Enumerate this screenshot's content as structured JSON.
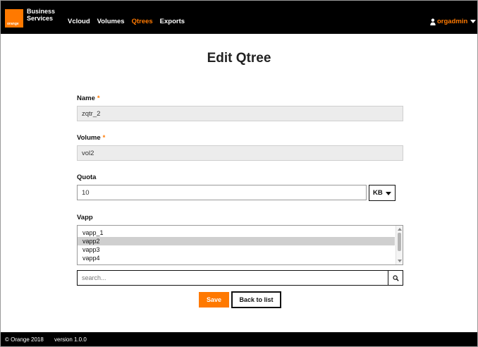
{
  "header": {
    "logo_text": "orange",
    "brand_line1": "Business",
    "brand_line2": "Services",
    "nav": [
      "Vcloud",
      "Volumes",
      "Qtrees",
      "Exports"
    ],
    "active_nav": "Qtrees",
    "user": "orgadmin"
  },
  "page": {
    "title": "Edit Qtree"
  },
  "form": {
    "name_label": "Name",
    "name_value": "zqtr_2",
    "volume_label": "Volume",
    "volume_value": "vol2",
    "required_mark": "*",
    "quota_label": "Quota",
    "quota_value": "10",
    "quota_unit": "KB",
    "vapp_label": "Vapp",
    "vapp_options": [
      "vapp_1",
      "vapp2",
      "vapp3",
      "vapp4"
    ],
    "vapp_selected": "vapp2",
    "search_placeholder": "search...",
    "save_label": "Save",
    "back_label": "Back to list"
  },
  "footer": {
    "copyright": "© Orange 2018",
    "version": "version 1.0.0"
  },
  "colors": {
    "accent": "#ff7900",
    "header_bg": "#000000",
    "field_bg": "#ececec"
  }
}
